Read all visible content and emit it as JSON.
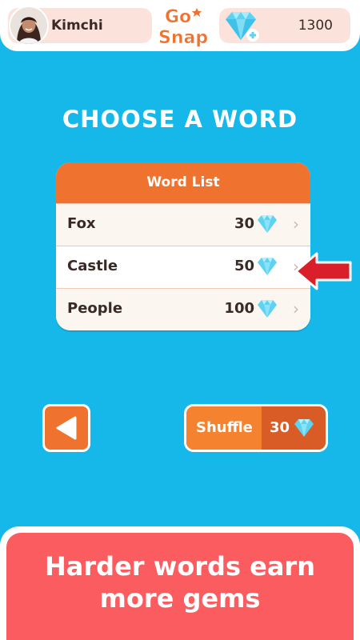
{
  "profile": {
    "name": "Kimchi"
  },
  "logo": {
    "line1": "Go",
    "line2": "Snap"
  },
  "gems": {
    "count": "1300"
  },
  "title": "CHOOSE A WORD",
  "word_list": {
    "header": "Word List",
    "items": [
      {
        "label": "Fox",
        "cost": "30"
      },
      {
        "label": "Castle",
        "cost": "50"
      },
      {
        "label": "People",
        "cost": "100"
      }
    ]
  },
  "shuffle": {
    "label": "Shuffle",
    "cost": "30"
  },
  "banner": {
    "line1": "Harder words earn",
    "line2": "more gems"
  },
  "colors": {
    "background": "#16b8ea",
    "header_orange": "#f0722f",
    "banner_red": "#fa5c5f",
    "gem": "#5fd2f2",
    "arrow_red": "#d9202a"
  }
}
